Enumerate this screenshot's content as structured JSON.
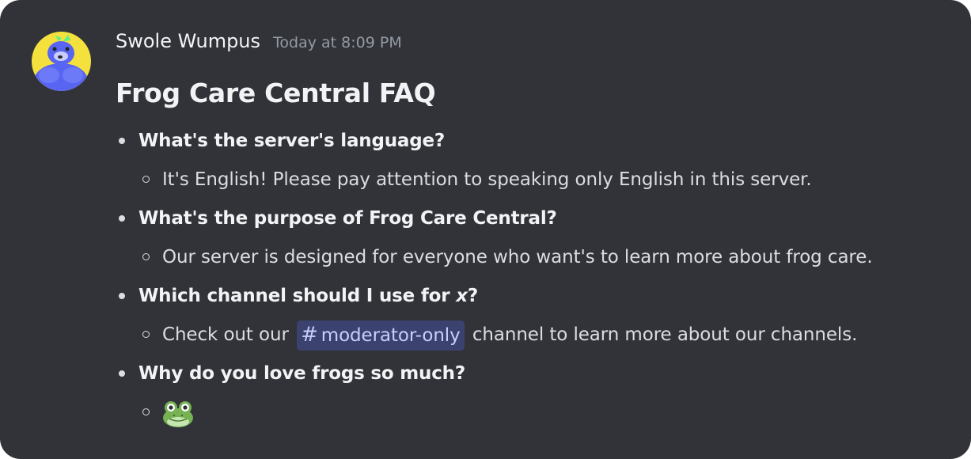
{
  "message": {
    "username": "Swole Wumpus",
    "timestamp": "Today at 8:09 PM",
    "title": "Frog Care Central FAQ",
    "faq": [
      {
        "question": "What's the server's language?",
        "answer": "It's English! Please pay attention to speaking only English in this server."
      },
      {
        "question": "What's the purpose of Frog Care Central?",
        "answer": "Our server is designed for everyone who want's to learn more about frog care."
      },
      {
        "question_prefix": "Which channel should I use for ",
        "question_italic": "x",
        "question_suffix": "?",
        "answer_prefix": "Check out our",
        "channel_mention": "moderator-only",
        "answer_suffix": "channel to learn more about our channels."
      },
      {
        "question": "Why do you love frogs so much?",
        "answer_emoji": "frog-emoji"
      }
    ]
  },
  "colors": {
    "background": "#313338",
    "username": "#f2f3f5",
    "timestamp": "#949ba4",
    "mention_bg": "#3c4270",
    "mention_text": "#c9cdfb"
  }
}
